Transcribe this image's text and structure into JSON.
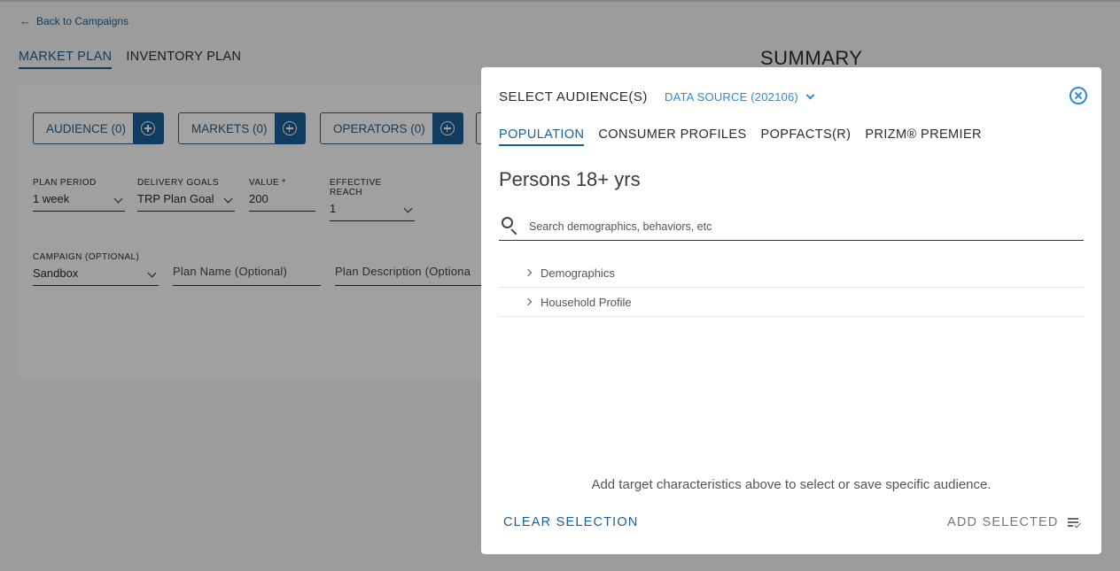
{
  "page": {
    "back_link": "Back to Campaigns",
    "plan_tabs": [
      {
        "label": "MARKET PLAN",
        "active": true
      },
      {
        "label": "INVENTORY PLAN",
        "active": false
      }
    ],
    "summary_title": "SUMMARY",
    "chips": [
      {
        "label": "AUDIENCE (0)"
      },
      {
        "label": "MARKETS (0)"
      },
      {
        "label": "OPERATORS (0)"
      }
    ],
    "fields": {
      "plan_period": {
        "label": "PLAN PERIOD",
        "value": "1 week"
      },
      "delivery_goals": {
        "label": "DELIVERY GOALS",
        "value": "TRP Plan Goal"
      },
      "value": {
        "label": "VALUE *",
        "value": "200"
      },
      "effective_reach": {
        "label": "EFFECTIVE REACH",
        "value": "1"
      },
      "campaign": {
        "label": "CAMPAIGN (OPTIONAL)",
        "value": "Sandbox"
      },
      "plan_name": {
        "placeholder": "Plan Name (Optional)"
      },
      "plan_description": {
        "placeholder": "Plan Description (Optiona"
      }
    }
  },
  "modal": {
    "title": "SELECT AUDIENCE(S)",
    "data_source": "DATA SOURCE (202106)",
    "tabs": [
      {
        "label": "POPULATION",
        "active": true
      },
      {
        "label": "CONSUMER PROFILES",
        "active": false
      },
      {
        "label": "POPFACTS(R)",
        "active": false
      },
      {
        "label": "PRIZM® PREMIER",
        "active": false
      }
    ],
    "heading": "Persons 18+ yrs",
    "search_placeholder": "Search demographics, behaviors, etc",
    "tree": [
      {
        "label": "Demographics"
      },
      {
        "label": "Household Profile"
      }
    ],
    "hint": "Add target characteristics above to select or save specific audience.",
    "clear_label": "CLEAR SELECTION",
    "add_label": "ADD SELECTED"
  },
  "colors": {
    "primary": "#1b5f95",
    "accent": "#2a8bd6"
  }
}
